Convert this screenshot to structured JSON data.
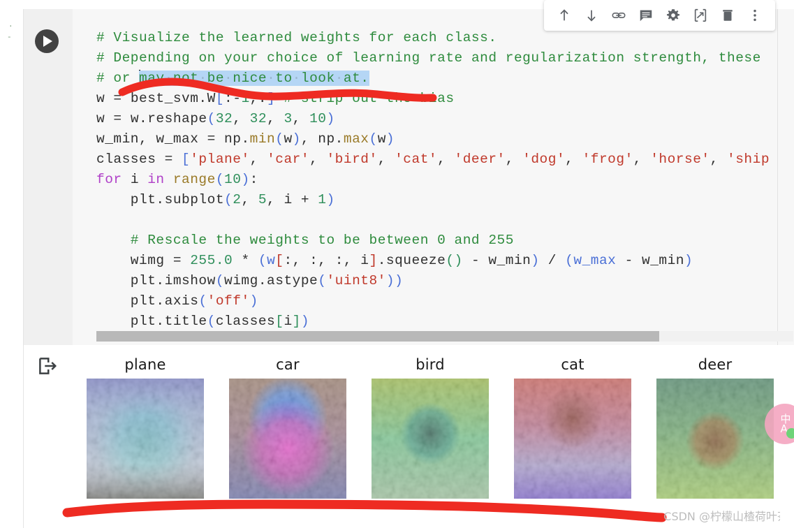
{
  "app": {
    "name": "colab-notebook",
    "watermark": "CSDN @柠檬山楂荷叶茶"
  },
  "toolbar": {
    "buttons": [
      {
        "name": "move-cell-up-button",
        "icon": "arrow-up-icon",
        "label": "Move cell up"
      },
      {
        "name": "move-cell-down-button",
        "icon": "arrow-down-icon",
        "label": "Move cell down"
      },
      {
        "name": "copy-cell-link-button",
        "icon": "link-icon",
        "label": "Link to cell"
      },
      {
        "name": "add-comment-button",
        "icon": "comment-icon",
        "label": "Add comment"
      },
      {
        "name": "cell-settings-button",
        "icon": "gear-icon",
        "label": "Settings"
      },
      {
        "name": "mirror-cell-button",
        "icon": "mirror-cell-icon",
        "label": "Mirror cell in tab"
      },
      {
        "name": "delete-cell-button",
        "icon": "trash-icon",
        "label": "Delete cell"
      },
      {
        "name": "more-options-button",
        "icon": "vertical-dots-icon",
        "label": "More cell actions"
      }
    ]
  },
  "cell": {
    "run_button_label": "Run cell",
    "output_icon_label": "Cell output",
    "selection_text": "may not be nice to look at.",
    "code_lines": [
      "# Visualize the learned weights for each class.",
      "# Depending on your choice of learning rate and regularization strength, these",
      "# or may not be nice to look at.",
      "w = best_svm.W[:-1,:] # strip out the bias",
      "w = w.reshape(32, 32, 3, 10)",
      "w_min, w_max = np.min(w), np.max(w)",
      "classes = ['plane', 'car', 'bird', 'cat', 'deer', 'dog', 'frog', 'horse', 'ship",
      "for i in range(10):",
      "    plt.subplot(2, 5, i + 1)",
      "",
      "    # Rescale the weights to be between 0 and 255",
      "    wimg = 255.0 * (w[:, :, :, i].squeeze() - w_min) / (w_max - w_min)",
      "    plt.imshow(wimg.astype('uint8'))",
      "    plt.axis('off')",
      "    plt.title(classes[i])"
    ],
    "classes": [
      "plane",
      "car",
      "bird",
      "cat",
      "deer",
      "dog",
      "frog",
      "horse",
      "ship"
    ],
    "stray_marks": [
      ".",
      "-"
    ]
  },
  "output": {
    "thumbnails": [
      {
        "label": "plane",
        "name": "weight-image-plane"
      },
      {
        "label": "car",
        "name": "weight-image-car"
      },
      {
        "label": "bird",
        "name": "weight-image-bird"
      },
      {
        "label": "cat",
        "name": "weight-image-cat"
      },
      {
        "label": "deer",
        "name": "weight-image-deer"
      }
    ]
  },
  "translate_widget": {
    "primary": "中",
    "secondary": "A"
  },
  "colors": {
    "comment": "#2e8b3d",
    "string": "#c0392b",
    "number": "#2f8f5b",
    "keyword": "#b040c8",
    "builtin": "#9a7a28",
    "bracket": "#4a6fd6",
    "selection": "#b5d6f5",
    "annotation": "#ee2b22",
    "cell_background": "#f7f7f7",
    "gutter_background": "#f0f0f0"
  }
}
